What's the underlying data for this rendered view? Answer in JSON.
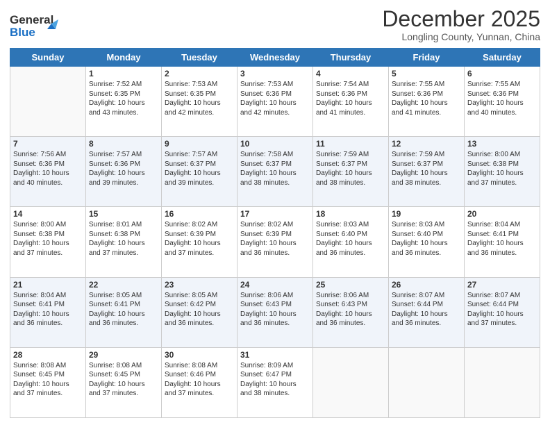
{
  "logo": {
    "line1": "General",
    "line2": "Blue"
  },
  "title": "December 2025",
  "subtitle": "Longling County, Yunnan, China",
  "days_of_week": [
    "Sunday",
    "Monday",
    "Tuesday",
    "Wednesday",
    "Thursday",
    "Friday",
    "Saturday"
  ],
  "weeks": [
    [
      {
        "day": "",
        "content": ""
      },
      {
        "day": "1",
        "content": "Sunrise: 7:52 AM\nSunset: 6:35 PM\nDaylight: 10 hours\nand 43 minutes."
      },
      {
        "day": "2",
        "content": "Sunrise: 7:53 AM\nSunset: 6:35 PM\nDaylight: 10 hours\nand 42 minutes."
      },
      {
        "day": "3",
        "content": "Sunrise: 7:53 AM\nSunset: 6:36 PM\nDaylight: 10 hours\nand 42 minutes."
      },
      {
        "day": "4",
        "content": "Sunrise: 7:54 AM\nSunset: 6:36 PM\nDaylight: 10 hours\nand 41 minutes."
      },
      {
        "day": "5",
        "content": "Sunrise: 7:55 AM\nSunset: 6:36 PM\nDaylight: 10 hours\nand 41 minutes."
      },
      {
        "day": "6",
        "content": "Sunrise: 7:55 AM\nSunset: 6:36 PM\nDaylight: 10 hours\nand 40 minutes."
      }
    ],
    [
      {
        "day": "7",
        "content": "Sunrise: 7:56 AM\nSunset: 6:36 PM\nDaylight: 10 hours\nand 40 minutes."
      },
      {
        "day": "8",
        "content": "Sunrise: 7:57 AM\nSunset: 6:36 PM\nDaylight: 10 hours\nand 39 minutes."
      },
      {
        "day": "9",
        "content": "Sunrise: 7:57 AM\nSunset: 6:37 PM\nDaylight: 10 hours\nand 39 minutes."
      },
      {
        "day": "10",
        "content": "Sunrise: 7:58 AM\nSunset: 6:37 PM\nDaylight: 10 hours\nand 38 minutes."
      },
      {
        "day": "11",
        "content": "Sunrise: 7:59 AM\nSunset: 6:37 PM\nDaylight: 10 hours\nand 38 minutes."
      },
      {
        "day": "12",
        "content": "Sunrise: 7:59 AM\nSunset: 6:37 PM\nDaylight: 10 hours\nand 38 minutes."
      },
      {
        "day": "13",
        "content": "Sunrise: 8:00 AM\nSunset: 6:38 PM\nDaylight: 10 hours\nand 37 minutes."
      }
    ],
    [
      {
        "day": "14",
        "content": "Sunrise: 8:00 AM\nSunset: 6:38 PM\nDaylight: 10 hours\nand 37 minutes."
      },
      {
        "day": "15",
        "content": "Sunrise: 8:01 AM\nSunset: 6:38 PM\nDaylight: 10 hours\nand 37 minutes."
      },
      {
        "day": "16",
        "content": "Sunrise: 8:02 AM\nSunset: 6:39 PM\nDaylight: 10 hours\nand 37 minutes."
      },
      {
        "day": "17",
        "content": "Sunrise: 8:02 AM\nSunset: 6:39 PM\nDaylight: 10 hours\nand 36 minutes."
      },
      {
        "day": "18",
        "content": "Sunrise: 8:03 AM\nSunset: 6:40 PM\nDaylight: 10 hours\nand 36 minutes."
      },
      {
        "day": "19",
        "content": "Sunrise: 8:03 AM\nSunset: 6:40 PM\nDaylight: 10 hours\nand 36 minutes."
      },
      {
        "day": "20",
        "content": "Sunrise: 8:04 AM\nSunset: 6:41 PM\nDaylight: 10 hours\nand 36 minutes."
      }
    ],
    [
      {
        "day": "21",
        "content": "Sunrise: 8:04 AM\nSunset: 6:41 PM\nDaylight: 10 hours\nand 36 minutes."
      },
      {
        "day": "22",
        "content": "Sunrise: 8:05 AM\nSunset: 6:41 PM\nDaylight: 10 hours\nand 36 minutes."
      },
      {
        "day": "23",
        "content": "Sunrise: 8:05 AM\nSunset: 6:42 PM\nDaylight: 10 hours\nand 36 minutes."
      },
      {
        "day": "24",
        "content": "Sunrise: 8:06 AM\nSunset: 6:43 PM\nDaylight: 10 hours\nand 36 minutes."
      },
      {
        "day": "25",
        "content": "Sunrise: 8:06 AM\nSunset: 6:43 PM\nDaylight: 10 hours\nand 36 minutes."
      },
      {
        "day": "26",
        "content": "Sunrise: 8:07 AM\nSunset: 6:44 PM\nDaylight: 10 hours\nand 36 minutes."
      },
      {
        "day": "27",
        "content": "Sunrise: 8:07 AM\nSunset: 6:44 PM\nDaylight: 10 hours\nand 37 minutes."
      }
    ],
    [
      {
        "day": "28",
        "content": "Sunrise: 8:08 AM\nSunset: 6:45 PM\nDaylight: 10 hours\nand 37 minutes."
      },
      {
        "day": "29",
        "content": "Sunrise: 8:08 AM\nSunset: 6:45 PM\nDaylight: 10 hours\nand 37 minutes."
      },
      {
        "day": "30",
        "content": "Sunrise: 8:08 AM\nSunset: 6:46 PM\nDaylight: 10 hours\nand 37 minutes."
      },
      {
        "day": "31",
        "content": "Sunrise: 8:09 AM\nSunset: 6:47 PM\nDaylight: 10 hours\nand 38 minutes."
      },
      {
        "day": "",
        "content": ""
      },
      {
        "day": "",
        "content": ""
      },
      {
        "day": "",
        "content": ""
      }
    ]
  ]
}
